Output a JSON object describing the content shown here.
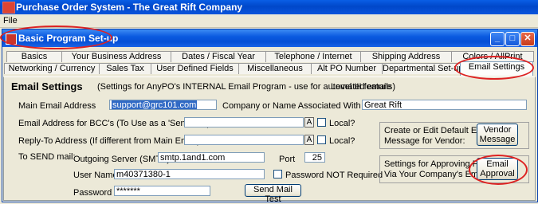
{
  "app_title": "Purchase Order System - The Great Rift Company",
  "menu": {
    "file": "File"
  },
  "window": {
    "title": "Basic Program Set-up",
    "min": "_",
    "max": "□",
    "close": "✕"
  },
  "tabs_row1": [
    "Basics",
    "Your Business Address",
    "Dates / Fiscal Year",
    "Telephone / Internet",
    "Shipping Address",
    "Colors / AllPrint"
  ],
  "tabs_row2": [
    "Networking / Currency",
    "Sales Tax",
    "User Defined Fields",
    "Miscellaneous",
    "Alt PO Number",
    "Departmental Set-up",
    "Email Settings"
  ],
  "email": {
    "heading": "Email Settings",
    "subheading": "(Settings for AnyPO's INTERNAL Email Program - use for automated emails)",
    "level": "Level III feature",
    "main_label": "Main Email Address",
    "main_value": "support@grc101.com",
    "company_label": "Company or Name Associated With Email",
    "company_value": "Great Rift",
    "bcc_label": "Email Address for BCC's (To Use as a 'Sent' Box)",
    "bcc_value": "",
    "a_btn": "A",
    "local": "Local?",
    "reply_label": "Reply-To Address (If different from Main Email)",
    "reply_value": "",
    "send_label": "To SEND mail:",
    "smtp_label": "Outgoing Server (SMTP)",
    "smtp_value": "smtp.1and1.com",
    "port_label": "Port",
    "port_value": "25",
    "user_label": "User Name",
    "user_value": "m40371380-1",
    "pw_not_req": "Password NOT Required",
    "pw_label": "Password",
    "pw_value": "*******",
    "send_test": "Send Mail Test",
    "vendor_text1": "Create or Edit Default Email",
    "vendor_text2": "Message for Vendor:",
    "vendor_btn1": "Vendor",
    "vendor_btn2": "Message",
    "approve_text1": "Settings for Approving PO's",
    "approve_text2": "Via Your Company's Email:",
    "approve_btn1": "Email",
    "approve_btn2": "Approval"
  }
}
